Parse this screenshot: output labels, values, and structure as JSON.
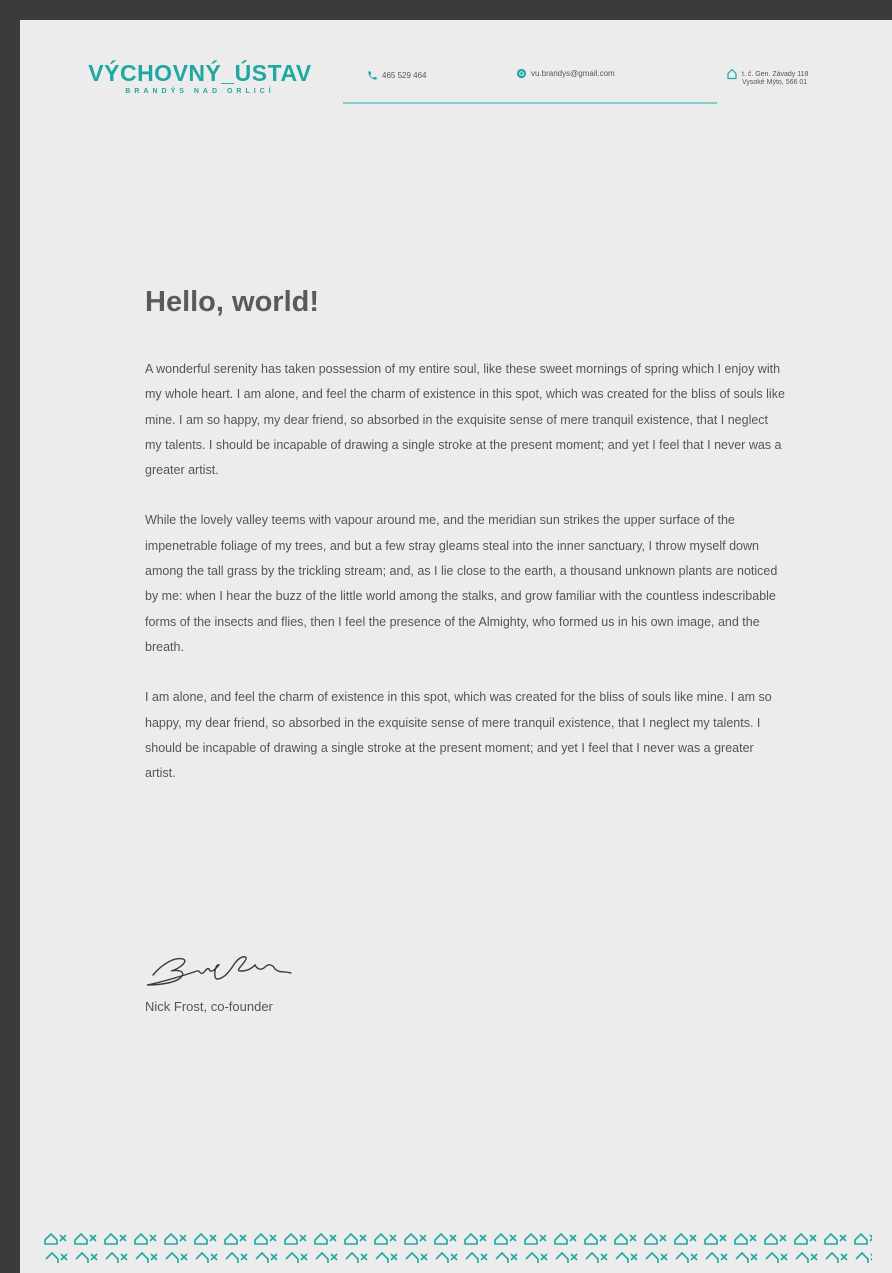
{
  "header": {
    "logo_title": "VÝCHOVNÝ_ÚSTAV",
    "logo_subtitle": "BRANDÝS NAD ORLICÍ",
    "phone": "465 529 464",
    "email": "vu.brandys@gmail.com",
    "address_line1": "t. č. Gen. Závady 118",
    "address_line2": "Vysoké Mýto, 566 01"
  },
  "letter": {
    "heading": "Hello, world!",
    "paragraphs": [
      "A wonderful serenity has taken possession of my entire soul, like these sweet mornings of spring which I enjoy with my whole heart. I am alone, and feel the charm of existence in this spot, which was created for the bliss of souls like mine. I am so happy, my dear friend, so absorbed in the exquisite sense of mere tranquil existence, that I neglect my talents. I should be incapable of drawing a single stroke at the present moment; and yet I feel that I never was a greater artist.",
      "While the lovely valley teems with vapour around me, and the meridian sun strikes the upper surface of the impenetrable foliage of my trees, and but a few stray gleams steal into the inner sanctuary, I throw myself down among the tall grass by the trickling stream; and, as I lie close to the earth, a thousand unknown plants are noticed by me: when I hear the buzz of the little world among the stalks, and grow familiar with the countless indescribable forms of the insects and flies, then I feel the presence of the Almighty, who formed us in his own image, and the breath.",
      "I am alone, and feel the charm of existence in this spot, which was created for the bliss of souls like mine. I am so happy, my dear friend, so absorbed in the exquisite sense of mere tranquil existence, that I neglect my talents. I should be incapable of drawing a single stroke at the present moment; and yet I feel that I never was a greater artist."
    ],
    "signer": "Nick Frost, co-founder"
  },
  "colors": {
    "accent": "#1fa8a1",
    "paper": "#ececec",
    "text": "#555555",
    "frame": "#3b3b3b"
  },
  "icons": [
    "phone-icon",
    "at-icon",
    "house-icon",
    "signature-mark",
    "footer-house-pattern"
  ]
}
